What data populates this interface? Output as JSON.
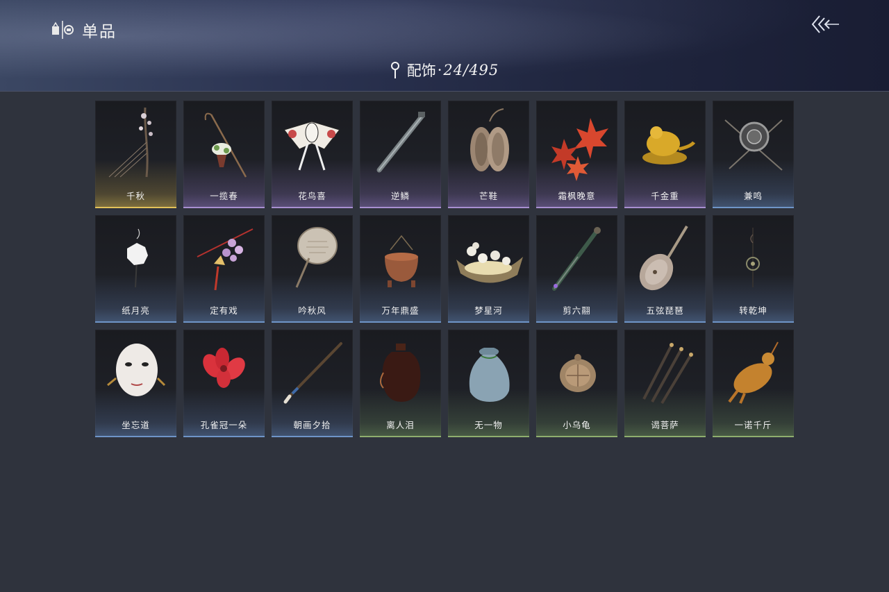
{
  "header": {
    "title": "单品",
    "title_icon": "wardrobe-icon",
    "back_icon": "back-arrow-icon"
  },
  "category": {
    "icon": "location-pin-icon",
    "label": "配饰",
    "separator": "·",
    "count": "24/495"
  },
  "rarity_colors": {
    "gold": "#e2c25a",
    "purple": "#a88fd0",
    "blue": "#6f95c8",
    "green": "#8fae6e"
  },
  "items": [
    {
      "name": "千秋",
      "rarity": "gold",
      "icon": "swing-branch-icon"
    },
    {
      "name": "一揽春",
      "rarity": "purple",
      "icon": "flower-basket-icon"
    },
    {
      "name": "花鸟喜",
      "rarity": "purple",
      "icon": "bird-kite-icon"
    },
    {
      "name": "逆鳞",
      "rarity": "purple",
      "icon": "flute-icon"
    },
    {
      "name": "芒鞋",
      "rarity": "purple",
      "icon": "straw-sandals-icon"
    },
    {
      "name": "霜枫晚意",
      "rarity": "purple",
      "icon": "maple-leaves-icon"
    },
    {
      "name": "千金重",
      "rarity": "purple",
      "icon": "golden-toad-icon"
    },
    {
      "name": "兼鸣",
      "rarity": "blue",
      "icon": "shield-ornament-icon"
    },
    {
      "name": "纸月亮",
      "rarity": "blue",
      "icon": "paper-moon-icon"
    },
    {
      "name": "定有戏",
      "rarity": "blue",
      "icon": "plum-blossom-pendant-icon"
    },
    {
      "name": "吟秋风",
      "rarity": "blue",
      "icon": "round-fan-icon"
    },
    {
      "name": "万年鼎盛",
      "rarity": "blue",
      "icon": "bronze-cauldron-icon"
    },
    {
      "name": "梦星河",
      "rarity": "blue",
      "icon": "flower-boat-icon"
    },
    {
      "name": "剪六翮",
      "rarity": "blue",
      "icon": "dagger-icon"
    },
    {
      "name": "五弦琵琶",
      "rarity": "blue",
      "icon": "pipa-icon"
    },
    {
      "name": "转乾坤",
      "rarity": "blue",
      "icon": "hanging-charm-icon"
    },
    {
      "name": "坐忘道",
      "rarity": "blue",
      "icon": "opera-mask-icon"
    },
    {
      "name": "孔雀冠一朵",
      "rarity": "blue",
      "icon": "red-flower-icon"
    },
    {
      "name": "朝画夕拾",
      "rarity": "blue",
      "icon": "brush-pen-icon"
    },
    {
      "name": "离人泪",
      "rarity": "green",
      "icon": "wine-jar-icon"
    },
    {
      "name": "无一物",
      "rarity": "green",
      "icon": "cloth-pouch-icon"
    },
    {
      "name": "小乌龟",
      "rarity": "green",
      "icon": "turtle-icon"
    },
    {
      "name": "谒菩萨",
      "rarity": "green",
      "icon": "darts-icon"
    },
    {
      "name": "一诺千斤",
      "rarity": "green",
      "icon": "roast-chicken-icon"
    }
  ]
}
